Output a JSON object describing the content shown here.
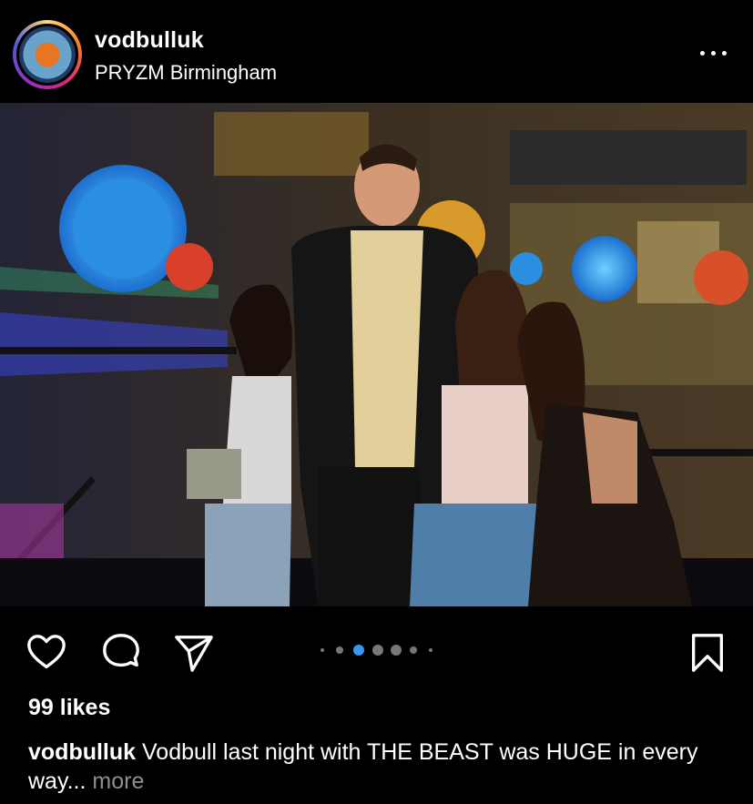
{
  "post": {
    "username": "vodbulluk",
    "location": "PRYZM Birmingham",
    "likes": "99 likes",
    "caption_user": "vodbulluk",
    "caption_text": "Vodbull last night with THE BEAST was HUGE in every way...",
    "more_label": "more",
    "carousel": {
      "total": 7,
      "active_index": 2
    }
  },
  "icons": {
    "more": "more-options-icon",
    "like": "heart-icon",
    "comment": "comment-icon",
    "share": "share-icon",
    "save": "bookmark-icon"
  },
  "colors": {
    "background": "#000000",
    "text": "#ffffff",
    "muted": "#8e8e8e",
    "active_dot": "#3897f0"
  }
}
